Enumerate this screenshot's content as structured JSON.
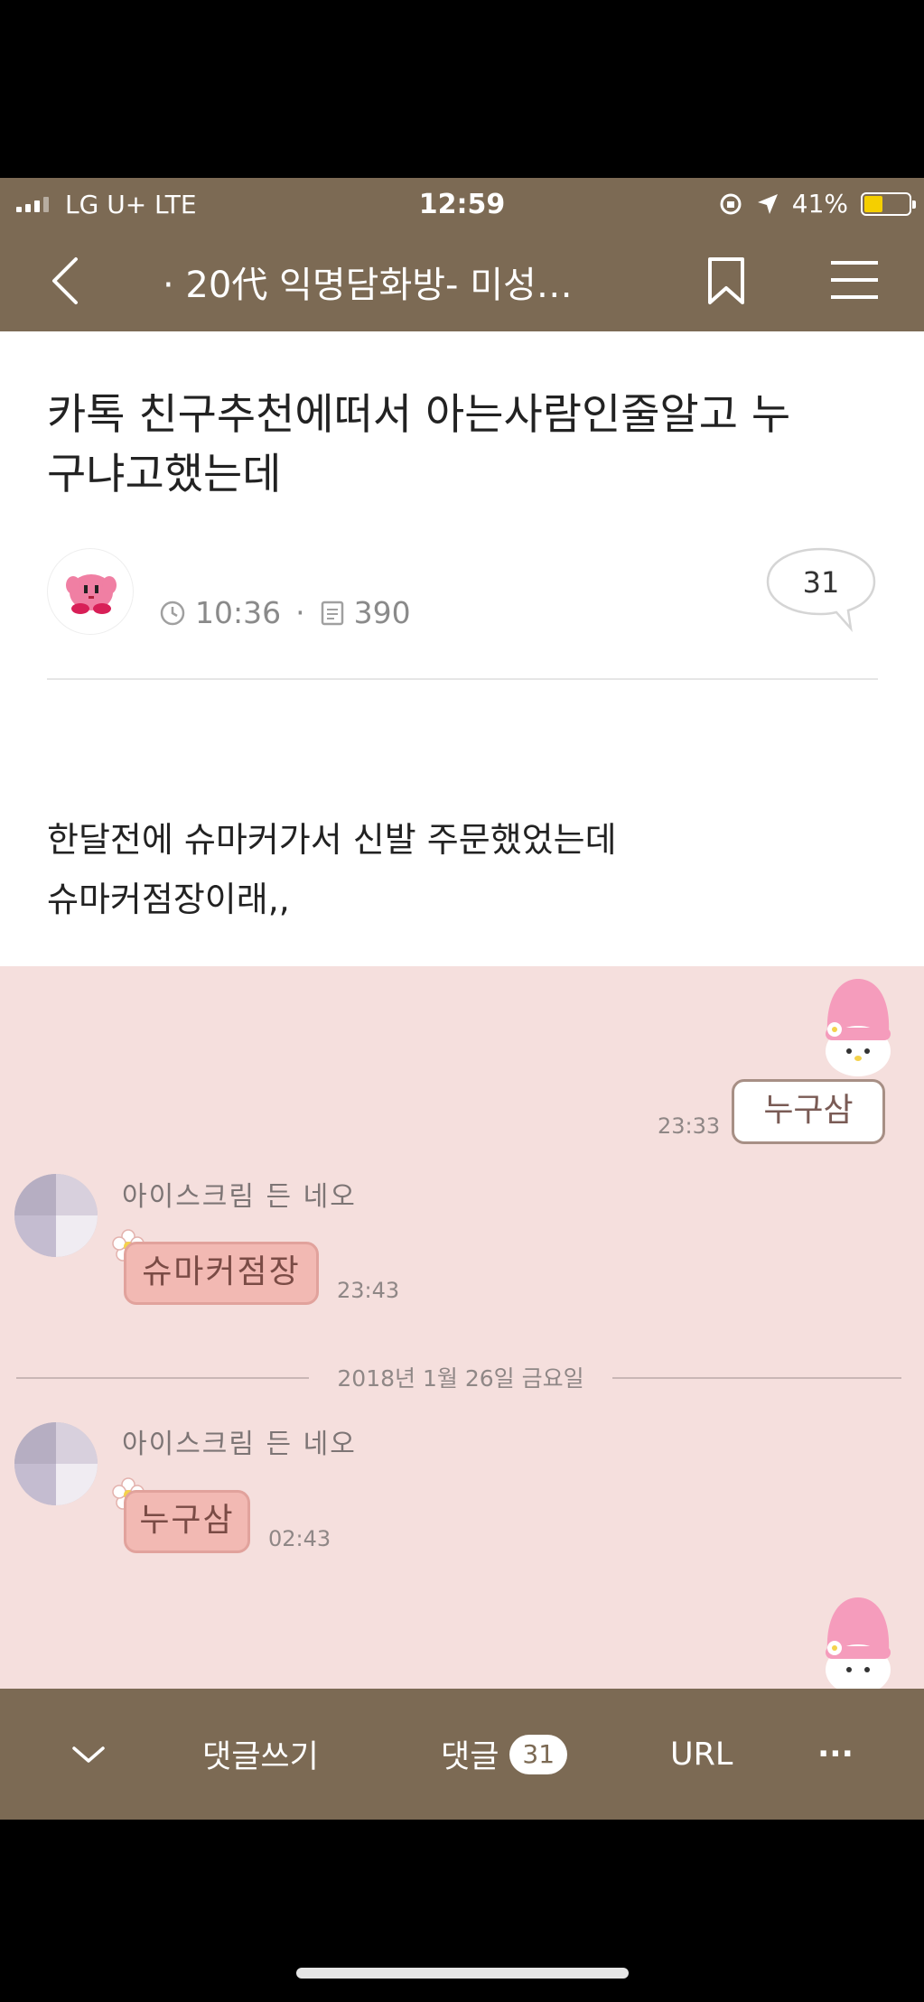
{
  "status_bar": {
    "carrier": "LG U+  LTE",
    "time": "12:59",
    "battery_text": "41%",
    "battery_level_percent": 41
  },
  "nav": {
    "title": "· 20代 익명담화방- 미성…",
    "icons": [
      "back-chevron-icon",
      "bookmark-icon",
      "hamburger-menu-icon"
    ]
  },
  "post": {
    "title_line1": "카톡 친구추천에떠서 아는사람인줄알고 누",
    "title_line2": "구냐고했는데",
    "time": "10:36",
    "views": "390",
    "comment_count": "31",
    "body_line1": "한달전에 슈마커가서 신발 주문했었는데",
    "body_line2": "슈마커점장이래,,"
  },
  "chat": {
    "my_message": "누구삼",
    "my_time": "23:33",
    "friend_name": "아이스크림 든 네오",
    "friend_message_1": "슈마커점장",
    "friend_time_1": "23:43",
    "date_divider": "2018년 1월 26일 금요일",
    "friend_message_2": "누구삼",
    "friend_time_2": "02:43",
    "colors": {
      "background": "#f5dfdd",
      "friend_bubble": "#f2b9b3"
    }
  },
  "toolbar": {
    "write_comment": "댓글쓰기",
    "comments_label": "댓글",
    "comments_badge": "31",
    "url_label": "URL",
    "more_label": "···",
    "brand_color": "#7c6a54"
  }
}
